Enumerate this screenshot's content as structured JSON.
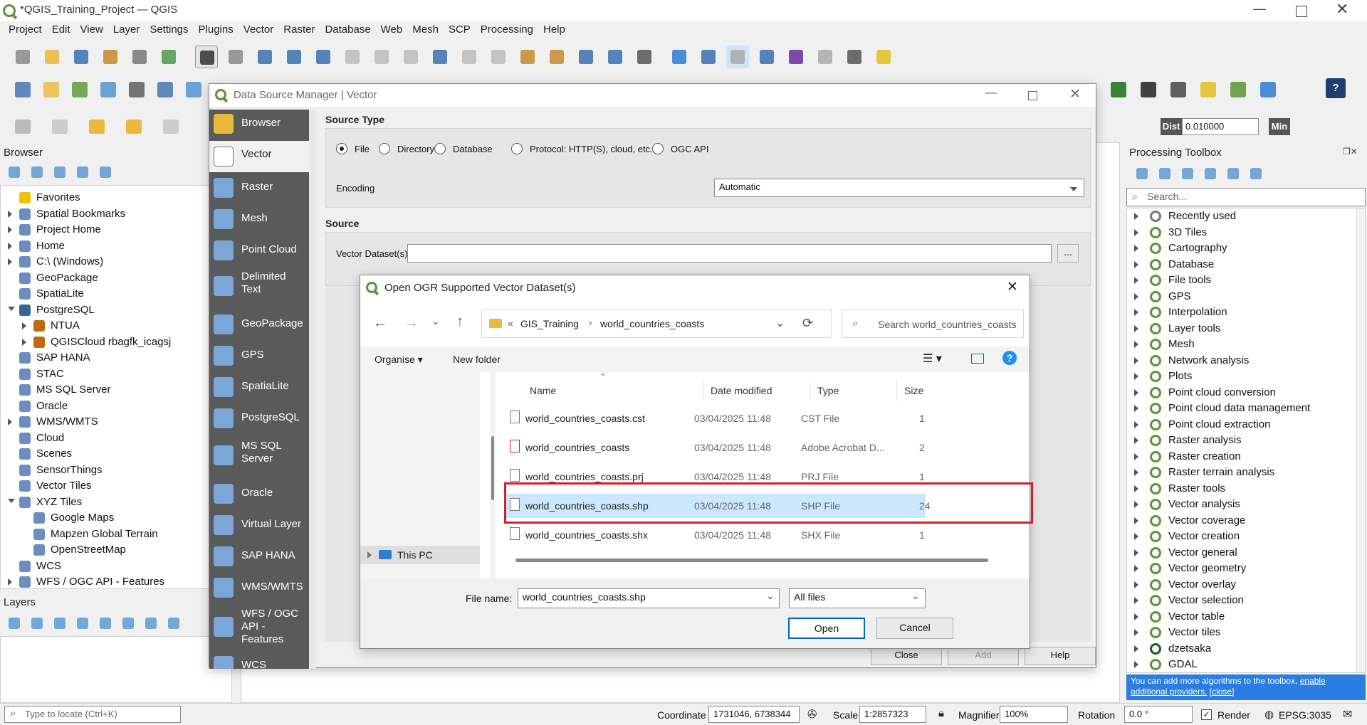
{
  "window": {
    "title": "*QGIS_Training_Project — QGIS"
  },
  "menu": [
    "Project",
    "Edit",
    "View",
    "Layer",
    "Settings",
    "Plugins",
    "Vector",
    "Raster",
    "Database",
    "Web",
    "Mesh",
    "SCP",
    "Processing",
    "Help"
  ],
  "toolbar": {
    "dist_label": "Dist",
    "dist_value": "0.010000",
    "min_label": "Min"
  },
  "browser": {
    "title": "Browser",
    "items": [
      {
        "label": "Favorites",
        "icon": "star-icon",
        "arrow": "none"
      },
      {
        "label": "Spatial Bookmarks",
        "icon": "bookmark-icon",
        "arrow": "right"
      },
      {
        "label": "Project Home",
        "icon": "project-home-icon",
        "arrow": "right"
      },
      {
        "label": "Home",
        "icon": "home-icon",
        "arrow": "right"
      },
      {
        "label": "C:\\ (Windows)",
        "icon": "drive-icon",
        "arrow": "right"
      },
      {
        "label": "GeoPackage",
        "icon": "geopackage-icon",
        "arrow": "none"
      },
      {
        "label": "SpatiaLite",
        "icon": "spatialite-icon",
        "arrow": "none"
      },
      {
        "label": "PostgreSQL",
        "icon": "postgresql-icon",
        "arrow": "down"
      },
      {
        "label": "NTUA",
        "icon": "connection-icon",
        "arrow": "right",
        "indent": 1
      },
      {
        "label": "QGISCloud rbagfk_icagsj",
        "icon": "connection-icon",
        "arrow": "right",
        "indent": 1
      },
      {
        "label": "SAP HANA",
        "icon": "sap-hana-icon",
        "arrow": "none"
      },
      {
        "label": "STAC",
        "icon": "stac-icon",
        "arrow": "none"
      },
      {
        "label": "MS SQL Server",
        "icon": "mssql-icon",
        "arrow": "none"
      },
      {
        "label": "Oracle",
        "icon": "oracle-icon",
        "arrow": "none"
      },
      {
        "label": "WMS/WMTS",
        "icon": "wms-icon",
        "arrow": "right"
      },
      {
        "label": "Cloud",
        "icon": "cloud-icon",
        "arrow": "none"
      },
      {
        "label": "Scenes",
        "icon": "scenes-icon",
        "arrow": "none"
      },
      {
        "label": "SensorThings",
        "icon": "sensorthings-icon",
        "arrow": "none"
      },
      {
        "label": "Vector Tiles",
        "icon": "vector-tiles-icon",
        "arrow": "none"
      },
      {
        "label": "XYZ Tiles",
        "icon": "xyz-icon",
        "arrow": "down"
      },
      {
        "label": "Google Maps",
        "icon": "grid-icon",
        "arrow": "none",
        "indent": 1
      },
      {
        "label": "Mapzen Global Terrain",
        "icon": "grid-icon",
        "arrow": "none",
        "indent": 1
      },
      {
        "label": "OpenStreetMap",
        "icon": "grid-icon",
        "arrow": "none",
        "indent": 1
      },
      {
        "label": "WCS",
        "icon": "wcs-icon",
        "arrow": "none"
      },
      {
        "label": "WFS / OGC API - Features",
        "icon": "wfs-icon",
        "arrow": "right"
      }
    ]
  },
  "layers": {
    "title": "Layers"
  },
  "dsm": {
    "title": "Data Source Manager | Vector",
    "sidebar": [
      {
        "label": "Browser",
        "icon": "folder-icon"
      },
      {
        "label": "Vector",
        "icon": "vector-icon"
      },
      {
        "label": "Raster",
        "icon": "raster-icon"
      },
      {
        "label": "Mesh",
        "icon": "mesh-icon"
      },
      {
        "label": "Point Cloud",
        "icon": "point-cloud-icon"
      },
      {
        "label": "Delimited Text",
        "icon": "delimited-text-icon"
      },
      {
        "label": "GeoPackage",
        "icon": "geopackage-icon"
      },
      {
        "label": "GPS",
        "icon": "gps-icon"
      },
      {
        "label": "SpatiaLite",
        "icon": "spatialite-icon"
      },
      {
        "label": "PostgreSQL",
        "icon": "postgresql-icon"
      },
      {
        "label": "MS SQL Server",
        "icon": "mssql-icon"
      },
      {
        "label": "Oracle",
        "icon": "oracle-icon"
      },
      {
        "label": "Virtual Layer",
        "icon": "virtual-layer-icon"
      },
      {
        "label": "SAP HANA",
        "icon": "sap-hana-icon"
      },
      {
        "label": "WMS/WMTS",
        "icon": "wms-icon"
      },
      {
        "label": "WFS / OGC API - Features",
        "icon": "wfs-icon"
      },
      {
        "label": "WCS",
        "icon": "wcs-icon"
      }
    ],
    "source_type_heading": "Source Type",
    "source_types": [
      "File",
      "Directory",
      "Database",
      "Protocol: HTTP(S), cloud, etc.",
      "OGC API"
    ],
    "encoding_label": "Encoding",
    "encoding_value": "Automatic",
    "source_heading": "Source",
    "dataset_label": "Vector Dataset(s)",
    "browse_label": "...",
    "close_label": "Close",
    "add_label": "Add",
    "help_label": "Help"
  },
  "file_dialog": {
    "title": "Open OGR Supported Vector Dataset(s)",
    "path": [
      "GIS_Training",
      "world_countries_coasts"
    ],
    "path_prefix": "«",
    "search_placeholder": "Search world_countries_coasts",
    "organise": "Organise",
    "new_folder": "New folder",
    "columns": {
      "name": "Name",
      "date": "Date modified",
      "type": "Type",
      "size": "Size"
    },
    "files": [
      {
        "name": "world_countries_coasts.cst",
        "date": "03/04/2025 11:48",
        "type": "CST File",
        "size": "1"
      },
      {
        "name": "world_countries_coasts",
        "date": "03/04/2025 11:48",
        "type": "Adobe Acrobat D...",
        "size": "2"
      },
      {
        "name": "world_countries_coasts.prj",
        "date": "03/04/2025 11:48",
        "type": "PRJ File",
        "size": "1"
      },
      {
        "name": "world_countries_coasts.shp",
        "date": "03/04/2025 11:48",
        "type": "SHP File",
        "size": "24"
      },
      {
        "name": "world_countries_coasts.shx",
        "date": "03/04/2025 11:48",
        "type": "SHX File",
        "size": "1"
      }
    ],
    "nav_this_pc": "This PC",
    "filename_label": "File name:",
    "filename_value": "world_countries_coasts.shp",
    "filter_value": "All files",
    "open_label": "Open",
    "cancel_label": "Cancel"
  },
  "toolbox": {
    "title": "Processing Toolbox",
    "search_placeholder": "Search...",
    "items": [
      "Recently used",
      "3D Tiles",
      "Cartography",
      "Database",
      "File tools",
      "GPS",
      "Interpolation",
      "Layer tools",
      "Mesh",
      "Network analysis",
      "Plots",
      "Point cloud conversion",
      "Point cloud data management",
      "Point cloud extraction",
      "Raster analysis",
      "Raster creation",
      "Raster terrain analysis",
      "Raster tools",
      "Vector analysis",
      "Vector coverage",
      "Vector creation",
      "Vector general",
      "Vector geometry",
      "Vector overlay",
      "Vector selection",
      "Vector table",
      "Vector tiles",
      "dzetsaka",
      "GDAL"
    ],
    "notice_text": "You can add more algorithms to the toolbox,",
    "notice_link1": "enable additional providers.",
    "notice_link2": "[close]"
  },
  "statusbar": {
    "locate_placeholder": "Type to locate (Ctrl+K)",
    "coordinate_label": "Coordinate",
    "coordinate_value": "1731046, 6738344",
    "scale_label": "Scale",
    "scale_value": "1:2857323",
    "magnifier_label": "Magnifier",
    "magnifier_value": "100%",
    "rotation_label": "Rotation",
    "rotation_value": "0.0 °",
    "render_label": "Render",
    "crs": "EPSG:3035"
  },
  "colors": {
    "accent": "#0067c0",
    "highlight": "#cce8ff",
    "annotation": "#d0202a",
    "qgis_green": "#589632",
    "dsm_sidebar": "#5a5a5a"
  }
}
